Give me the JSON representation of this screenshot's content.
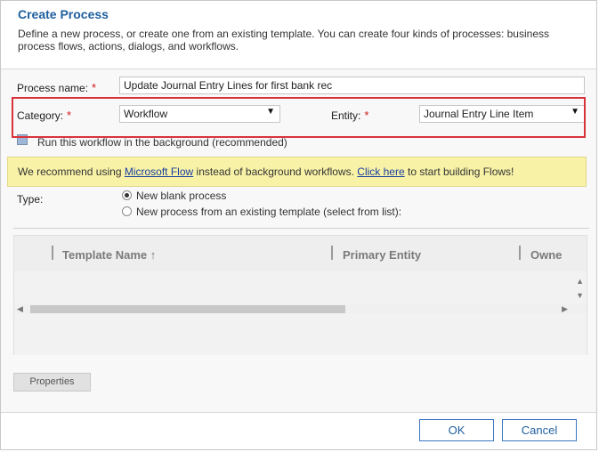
{
  "header": {
    "title": "Create Process",
    "subtitle": "Define a new process, or create one from an existing template. You can create four kinds of processes: business process flows, actions, dialogs, and workflows."
  },
  "form": {
    "process_name_label": "Process name:",
    "process_name_value": "Update Journal Entry Lines for first bank rec",
    "required_mark": "*",
    "category_label": "Category:",
    "category_value": "Workflow",
    "entity_label": "Entity:",
    "entity_value": "Journal Entry Line Item",
    "dropdown_arrow": "▼",
    "background_checkbox_label": "Run this workflow in the background (recommended)",
    "background_checkbox_checked": true
  },
  "banner": {
    "text_before": "We recommend using ",
    "link1": "Microsoft Flow",
    "text_middle": " instead of background workflows. ",
    "link2": "Click here",
    "text_after": " to start building Flows!",
    "color": "#f8f2a7"
  },
  "type": {
    "label": "Type:",
    "option1": "New blank process",
    "option2": "New process from an existing template (select from list):",
    "selected": "New blank process"
  },
  "grid": {
    "columns": [
      "Template Name ↑",
      "Primary Entity",
      "Owne"
    ],
    "scroll_up_icon": "▲",
    "scroll_down_icon": "▼",
    "scroll_left_icon": "◀",
    "scroll_right_icon": "▶"
  },
  "buttons": {
    "properties": "Properties",
    "ok": "OK",
    "cancel": "Cancel"
  },
  "colors": {
    "title": "#1f5f9e",
    "highlight_border": "#d9333a",
    "required": "#d31515",
    "link": "#1a3f9e"
  }
}
